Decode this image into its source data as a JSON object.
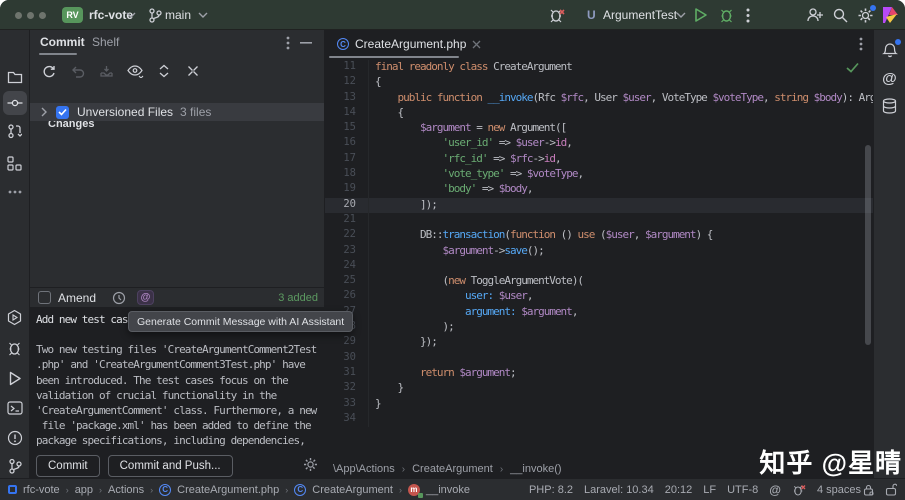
{
  "topbar": {
    "project_initials": "RV",
    "project_name": "rfc-vote",
    "branch": "main",
    "run_config": "ArgumentTest"
  },
  "commit_panel": {
    "tab_commit": "Commit",
    "tab_shelf": "Shelf",
    "changes_label": "Changes",
    "unversioned_label": "Unversioned Files",
    "unversioned_count": "3 files",
    "amend_label": "Amend",
    "added_badge": "3 added",
    "message_title": "Add new test case",
    "tooltip": "Generate Commit Message with AI Assistant",
    "message_lines": [
      "Two new testing files 'CreateArgumentComment2Test",
      ".php' and 'CreateArgumentComment3Test.php' have",
      "been introduced. The test cases focus on the",
      "validation of crucial functionality in the",
      "'CreateArgumentComment' class. Furthermore, a new",
      " file 'package.xml' has been added to define the",
      "package specifications, including dependencies,"
    ],
    "commit_button": "Commit",
    "commit_push_button": "Commit and Push..."
  },
  "editor": {
    "tab_label": "CreateArgument.php",
    "breadcrumbs": [
      "\\App\\Actions",
      "CreateArgument",
      "__invoke()"
    ],
    "code_lines": [
      {
        "n": 11,
        "t": [
          [
            "kw",
            "final readonly class "
          ],
          [
            "cls",
            "CreateArgument"
          ]
        ]
      },
      {
        "n": 12,
        "t": [
          [
            "plain",
            "{"
          ]
        ]
      },
      {
        "n": 13,
        "t": [
          [
            "plain",
            "    "
          ],
          [
            "kw",
            "public function "
          ],
          [
            "fn",
            "__invoke"
          ],
          [
            "plain",
            "("
          ],
          [
            "cls",
            "Rfc"
          ],
          [
            "plain",
            " "
          ],
          [
            "var",
            "$rfc"
          ],
          [
            "plain",
            ", "
          ],
          [
            "cls",
            "User"
          ],
          [
            "plain",
            " "
          ],
          [
            "var",
            "$user"
          ],
          [
            "plain",
            ", "
          ],
          [
            "cls",
            "VoteType"
          ],
          [
            "plain",
            " "
          ],
          [
            "var",
            "$voteType"
          ],
          [
            "plain",
            ", "
          ],
          [
            "kw",
            "string"
          ],
          [
            "plain",
            " "
          ],
          [
            "var",
            "$body"
          ],
          [
            "plain",
            "): "
          ],
          [
            "cls",
            "Argument"
          ]
        ]
      },
      {
        "n": 14,
        "t": [
          [
            "plain",
            "    {"
          ]
        ]
      },
      {
        "n": 15,
        "t": [
          [
            "plain",
            "        "
          ],
          [
            "var",
            "$argument"
          ],
          [
            "plain",
            " = "
          ],
          [
            "kw",
            "new"
          ],
          [
            "plain",
            " "
          ],
          [
            "cls",
            "Argument"
          ],
          [
            "plain",
            "(["
          ]
        ]
      },
      {
        "n": 16,
        "t": [
          [
            "plain",
            "            "
          ],
          [
            "str",
            "'user_id'"
          ],
          [
            "plain",
            " => "
          ],
          [
            "var",
            "$user"
          ],
          [
            "plain",
            "->"
          ],
          [
            "prop",
            "id"
          ],
          [
            "plain",
            ","
          ]
        ]
      },
      {
        "n": 17,
        "t": [
          [
            "plain",
            "            "
          ],
          [
            "str",
            "'rfc_id'"
          ],
          [
            "plain",
            " => "
          ],
          [
            "var",
            "$rfc"
          ],
          [
            "plain",
            "->"
          ],
          [
            "prop",
            "id"
          ],
          [
            "plain",
            ","
          ]
        ]
      },
      {
        "n": 18,
        "t": [
          [
            "plain",
            "            "
          ],
          [
            "str",
            "'vote_type'"
          ],
          [
            "plain",
            " => "
          ],
          [
            "var",
            "$voteType"
          ],
          [
            "plain",
            ","
          ]
        ]
      },
      {
        "n": 19,
        "t": [
          [
            "plain",
            "            "
          ],
          [
            "str",
            "'body'"
          ],
          [
            "plain",
            " => "
          ],
          [
            "var",
            "$body"
          ],
          [
            "plain",
            ","
          ]
        ]
      },
      {
        "n": 20,
        "t": [
          [
            "plain",
            "        ]);"
          ]
        ],
        "current": true
      },
      {
        "n": 21,
        "t": []
      },
      {
        "n": 22,
        "t": [
          [
            "plain",
            "        "
          ],
          [
            "cls",
            "DB"
          ],
          [
            "plain",
            "::"
          ],
          [
            "fn",
            "transaction"
          ],
          [
            "plain",
            "("
          ],
          [
            "kw",
            "function"
          ],
          [
            "plain",
            " () "
          ],
          [
            "kw",
            "use"
          ],
          [
            "plain",
            " ("
          ],
          [
            "var",
            "$user"
          ],
          [
            "plain",
            ", "
          ],
          [
            "var",
            "$argument"
          ],
          [
            "plain",
            ") {"
          ]
        ]
      },
      {
        "n": 23,
        "t": [
          [
            "plain",
            "            "
          ],
          [
            "var",
            "$argument"
          ],
          [
            "plain",
            "->"
          ],
          [
            "fn",
            "save"
          ],
          [
            "plain",
            "();"
          ]
        ]
      },
      {
        "n": 24,
        "t": []
      },
      {
        "n": 25,
        "t": [
          [
            "plain",
            "            ("
          ],
          [
            "kw",
            "new"
          ],
          [
            "plain",
            " "
          ],
          [
            "cls",
            "ToggleArgumentVote"
          ],
          [
            "plain",
            ")("
          ]
        ]
      },
      {
        "n": 26,
        "t": [
          [
            "plain",
            "                "
          ],
          [
            "narg",
            "user:"
          ],
          [
            "plain",
            " "
          ],
          [
            "var",
            "$user"
          ],
          [
            "plain",
            ","
          ]
        ]
      },
      {
        "n": 27,
        "t": [
          [
            "plain",
            "                "
          ],
          [
            "narg",
            "argument:"
          ],
          [
            "plain",
            " "
          ],
          [
            "var",
            "$argument"
          ],
          [
            "plain",
            ","
          ]
        ]
      },
      {
        "n": 28,
        "t": [
          [
            "plain",
            "            );"
          ]
        ]
      },
      {
        "n": 29,
        "t": [
          [
            "plain",
            "        });"
          ]
        ]
      },
      {
        "n": 30,
        "t": []
      },
      {
        "n": 31,
        "t": [
          [
            "plain",
            "        "
          ],
          [
            "kw",
            "return"
          ],
          [
            "plain",
            " "
          ],
          [
            "var",
            "$argument"
          ],
          [
            "plain",
            ";"
          ]
        ]
      },
      {
        "n": 32,
        "t": [
          [
            "plain",
            "    }"
          ]
        ]
      },
      {
        "n": 33,
        "t": [
          [
            "plain",
            "}"
          ]
        ]
      },
      {
        "n": 34,
        "t": []
      }
    ]
  },
  "status_bar": {
    "crumbs": [
      {
        "icon": "project",
        "label": "rfc-vote"
      },
      {
        "icon": "",
        "label": "app"
      },
      {
        "icon": "",
        "label": "Actions"
      },
      {
        "icon": "class",
        "label": "CreateArgument.php"
      },
      {
        "icon": "class",
        "label": "CreateArgument"
      },
      {
        "icon": "method",
        "label": "__invoke"
      }
    ],
    "php_version": "PHP: 8.2",
    "laravel_version": "Laravel: 10.34",
    "position": "20:12",
    "line_separator": "LF",
    "encoding": "UTF-8",
    "indent": "4 spaces"
  },
  "watermark": "知乎 @星晴",
  "colors": {
    "accent_blue": "#3574F0",
    "green": "#5C9A61",
    "run_green": "#5FAD65",
    "error_red": "#DB5C5C",
    "topbar_bg": "#2E3A33",
    "panel_bg": "#2B2D30",
    "editor_bg": "#1E1F22",
    "syntax": {
      "kw": "#CF8E6D",
      "cls": "#BCBEC4",
      "fn": "#56A8F5",
      "var": "#B189C5",
      "prop": "#C77DBB",
      "str": "#6AAB73",
      "narg": "#56A8F5",
      "plain": "#BCBEC4"
    }
  }
}
